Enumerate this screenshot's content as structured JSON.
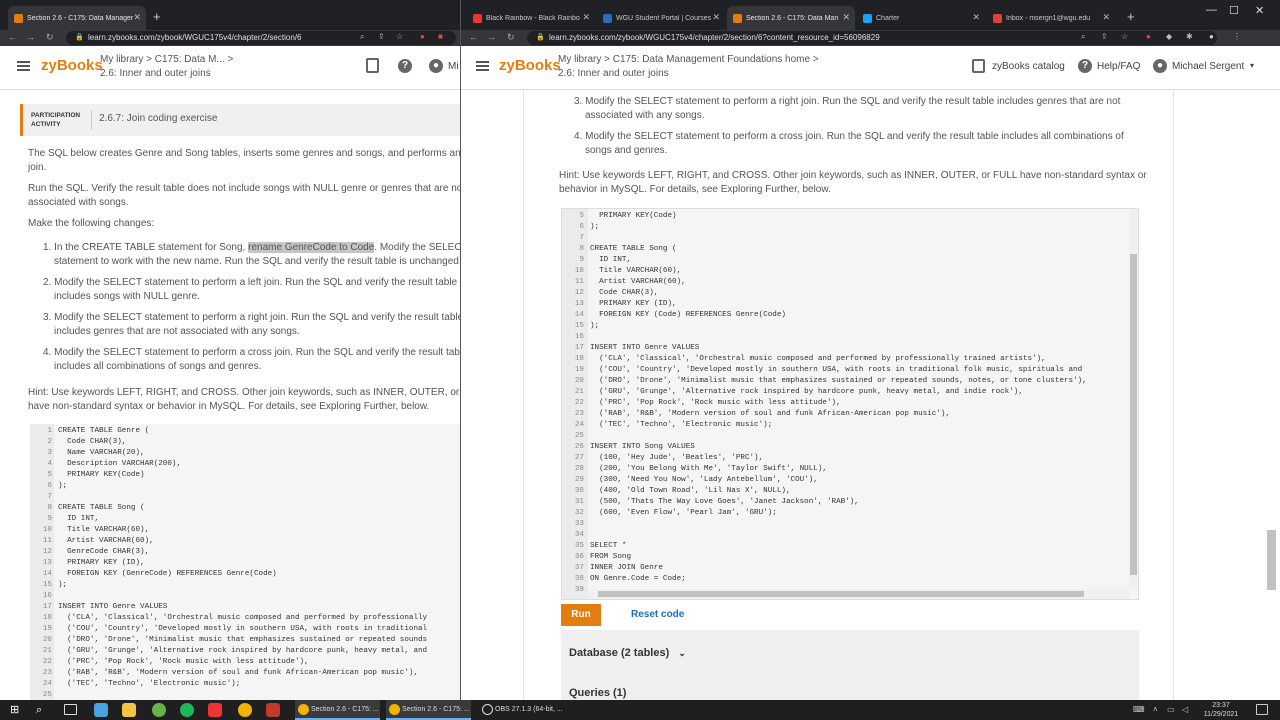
{
  "left_window": {
    "tabs": [
      {
        "title": "Section 2.6 - C175: Data Manager"
      }
    ],
    "url": "learn.zybooks.com/zybook/WGUC175v4/chapter/2/section/6",
    "header": {
      "logo": "zyBooks",
      "crumb_line1": "My library > C175: Data M...  >",
      "crumb_line2": "2.6: Inner and outer joins",
      "cut_text": "Mi"
    },
    "activity": {
      "label_line1": "PARTICIPATION",
      "label_line2": "ACTIVITY",
      "title": "2.6.7: Join coding exercise"
    },
    "paragraphs": {
      "p1_line1": "The SQL below creates Genre and Song tables, inserts some genres and songs, and performs an",
      "p1_line2": "join.",
      "p2_line1": "Run the SQL. Verify the result table does not include songs with NULL genre or genres that are no",
      "p2_line2": "associated with songs.",
      "p3": "Make the following changes:",
      "hint_line1": "Hint: Use keywords LEFT, RIGHT, and CROSS. Other join keywords, such as INNER, OUTER, or FUL",
      "hint_line2": "have non-standard syntax or behavior in MySQL. For details, see Exploring Further, below."
    },
    "steps": [
      {
        "num": "1.",
        "l1a": "In the CREATE TABLE statement for Song, ",
        "l1hl": "rename GenreCode to Code",
        "l1b": ". Modify the SELECT",
        "l2": "statement to work with the new name. Run the SQL and verify the result table is unchanged."
      },
      {
        "num": "2.",
        "l1": "Modify the SELECT statement to perform a left join. Run the SQL and verify the result table",
        "l2": "includes songs with NULL genre."
      },
      {
        "num": "3.",
        "l1": "Modify the SELECT statement to perform a right join. Run the SQL and verify the result table",
        "l2": "includes genres that are not associated with any songs."
      },
      {
        "num": "4.",
        "l1": "Modify the SELECT statement to perform a cross join. Run the SQL and verify the result tabl",
        "l2": "includes all combinations of songs and genres."
      }
    ],
    "code": [
      {
        "n": "1",
        "t": "CREATE TABLE Genre ("
      },
      {
        "n": "2",
        "t": "  Code CHAR(3),"
      },
      {
        "n": "3",
        "t": "  Name VARCHAR(20),"
      },
      {
        "n": "4",
        "t": "  Description VARCHAR(200),"
      },
      {
        "n": "5",
        "t": "  PRIMARY KEY(Code)"
      },
      {
        "n": "6",
        "t": ");"
      },
      {
        "n": "7",
        "t": ""
      },
      {
        "n": "8",
        "t": "CREATE TABLE Song ("
      },
      {
        "n": "9",
        "t": "  ID INT,"
      },
      {
        "n": "10",
        "t": "  Title VARCHAR(60),"
      },
      {
        "n": "11",
        "t": "  Artist VARCHAR(60),"
      },
      {
        "n": "12",
        "t": "  GenreCode CHAR(3),"
      },
      {
        "n": "13",
        "t": "  PRIMARY KEY (ID),"
      },
      {
        "n": "14",
        "t": "  FOREIGN KEY (GenreCode) REFERENCES Genre(Code)"
      },
      {
        "n": "15",
        "t": ");"
      },
      {
        "n": "16",
        "t": ""
      },
      {
        "n": "17",
        "t": "INSERT INTO Genre VALUES"
      },
      {
        "n": "18",
        "t": "  ('CLA', 'Classical', 'Orchestral music composed and performed by professionally"
      },
      {
        "n": "19",
        "t": "  ('COU', 'Country', 'Developed mostly in southern USA, with roots in traditional"
      },
      {
        "n": "20",
        "t": "  ('DRO', 'Drone', 'Minimalist music that emphasizes sustained or repeated sounds"
      },
      {
        "n": "21",
        "t": "  ('GRU', 'Grunge', 'Alternative rock inspired by hardcore punk, heavy metal, and"
      },
      {
        "n": "22",
        "t": "  ('PRC', 'Pop Rock', 'Rock music with less attitude'),"
      },
      {
        "n": "23",
        "t": "  ('RAB', 'R&B', 'Modern version of soul and funk African-American pop music'),"
      },
      {
        "n": "24",
        "t": "  ('TEC', 'Techno', 'Electronic music');"
      },
      {
        "n": "25",
        "t": ""
      }
    ]
  },
  "right_window": {
    "tabs": [
      {
        "title": "Black Rainbow - Black Rainbo"
      },
      {
        "title": "WGU Student Portal | Courses"
      },
      {
        "title": "Section 2.6 - C175: Data Man"
      },
      {
        "title": "Charter"
      },
      {
        "title": "Inbox - msergn1@wgu.edu"
      }
    ],
    "url": "learn.zybooks.com/zybook/WGUC175v4/chapter/2/section/6?content_resource_id=56096829",
    "header": {
      "logo": "zyBooks",
      "crumb_line1": "My library > C175: Data Management Foundations home  >",
      "crumb_line2": "2.6: Inner and outer joins",
      "catalog": "zyBooks catalog",
      "help": "Help/FAQ",
      "user": "Michael Sergent"
    },
    "steps": [
      {
        "num": "3.",
        "l1": "Modify the SELECT statement to perform a right join. Run the SQL and verify the result table includes genres that are not",
        "l2": "associated with any songs."
      },
      {
        "num": "4.",
        "l1": "Modify the SELECT statement to perform a cross join. Run the SQL and verify the result table includes all combinations of",
        "l2": "songs and genres."
      }
    ],
    "hint_line1": "Hint: Use keywords LEFT, RIGHT, and CROSS. Other join keywords, such as INNER, OUTER, or FULL have non-standard syntax or",
    "hint_line2": "behavior in MySQL. For details, see Exploring Further, below.",
    "code": [
      {
        "n": "5",
        "t": "  PRIMARY KEY(Code)"
      },
      {
        "n": "6",
        "t": ");"
      },
      {
        "n": "7",
        "t": ""
      },
      {
        "n": "8",
        "t": "CREATE TABLE Song ("
      },
      {
        "n": "9",
        "t": "  ID INT,"
      },
      {
        "n": "10",
        "t": "  Title VARCHAR(60),"
      },
      {
        "n": "11",
        "t": "  Artist VARCHAR(60),"
      },
      {
        "n": "12",
        "t": "  Code CHAR(3),"
      },
      {
        "n": "13",
        "t": "  PRIMARY KEY (ID),"
      },
      {
        "n": "14",
        "t": "  FOREIGN KEY (Code) REFERENCES Genre(Code)"
      },
      {
        "n": "15",
        "t": ");"
      },
      {
        "n": "16",
        "t": ""
      },
      {
        "n": "17",
        "t": "INSERT INTO Genre VALUES"
      },
      {
        "n": "18",
        "t": "  ('CLA', 'Classical', 'Orchestral music composed and performed by professionally trained artists'),"
      },
      {
        "n": "19",
        "t": "  ('COU', 'Country', 'Developed mostly in southern USA, with roots in traditional folk music, spirituals and"
      },
      {
        "n": "20",
        "t": "  ('DRO', 'Drone', 'Minimalist music that emphasizes sustained or repeated sounds, notes, or tone clusters'),"
      },
      {
        "n": "21",
        "t": "  ('GRU', 'Grunge', 'Alternative rock inspired by hardcore punk, heavy metal, and indie rock'),"
      },
      {
        "n": "22",
        "t": "  ('PRC', 'Pop Rock', 'Rock music with less attitude'),"
      },
      {
        "n": "23",
        "t": "  ('RAB', 'R&B', 'Modern version of soul and funk African-American pop music'),"
      },
      {
        "n": "24",
        "t": "  ('TEC', 'Techno', 'Electronic music');"
      },
      {
        "n": "25",
        "t": ""
      },
      {
        "n": "26",
        "t": "INSERT INTO Song VALUES"
      },
      {
        "n": "27",
        "t": "  (100, 'Hey Jude', 'Beatles', 'PRC'),"
      },
      {
        "n": "28",
        "t": "  (200, 'You Belong With Me', 'Taylor Swift', NULL),"
      },
      {
        "n": "29",
        "t": "  (300, 'Need You Now', 'Lady Antebellum', 'COU'),"
      },
      {
        "n": "30",
        "t": "  (400, 'Old Town Road', 'Lil Nas X', NULL),"
      },
      {
        "n": "31",
        "t": "  (500, 'Thats The Way Love Goes', 'Janet Jackson', 'RAB'),"
      },
      {
        "n": "32",
        "t": "  (600, 'Even Flow', 'Pearl Jam', 'GRU');"
      },
      {
        "n": "33",
        "t": ""
      },
      {
        "n": "34",
        "t": ""
      },
      {
        "n": "35",
        "t": "SELECT *"
      },
      {
        "n": "36",
        "t": "FROM Song"
      },
      {
        "n": "37",
        "t": "INNER JOIN Genre"
      },
      {
        "n": "38",
        "t": "ON Genre.Code = Code;"
      },
      {
        "n": "39",
        "t": ""
      }
    ],
    "run_label": "Run",
    "reset_label": "Reset code",
    "db_label": "Database (2 tables)",
    "queries_label": "Queries (1)"
  },
  "taskbar": {
    "apps": [
      {
        "title": "Section 2.6 - C175: ..."
      },
      {
        "title": "Section 2.6 - C175: ..."
      },
      {
        "title": "OBS 27.1.3 (64-bit, ..."
      }
    ],
    "time": "23:37",
    "date": "11/29/2021"
  },
  "colors": {
    "zybooks_orange": "#e47d0f",
    "chrome_dark": "#202124",
    "link_blue": "#1b6fbf"
  }
}
